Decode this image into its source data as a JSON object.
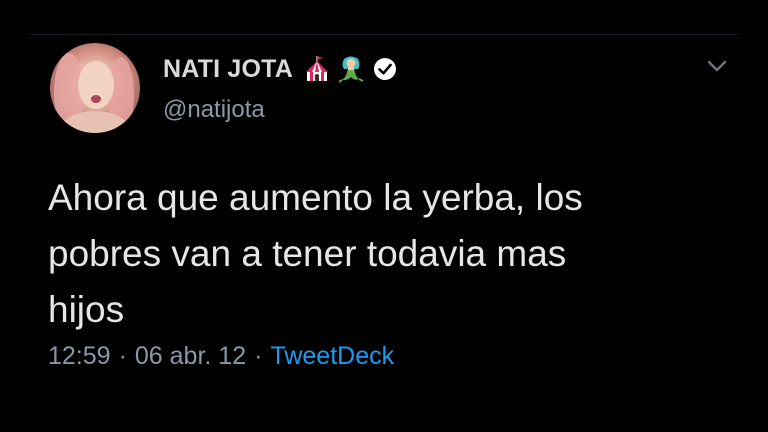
{
  "tweet": {
    "author": {
      "display_name": "NATI JOTA",
      "handle": "@natijota",
      "verified": true,
      "name_emojis": [
        "circus-tent-icon",
        "mermaid-icon"
      ]
    },
    "text": "Ahora que aumento la yerba, los\npobres van a tener todavia mas\nhijos",
    "time": "12:59",
    "date": "06 abr. 12",
    "separator": "·",
    "source": "TweetDeck"
  },
  "colors": {
    "background": "#000000",
    "text": "#e6e6e6",
    "muted": "#8b98a5",
    "link": "#1d9bf0"
  }
}
